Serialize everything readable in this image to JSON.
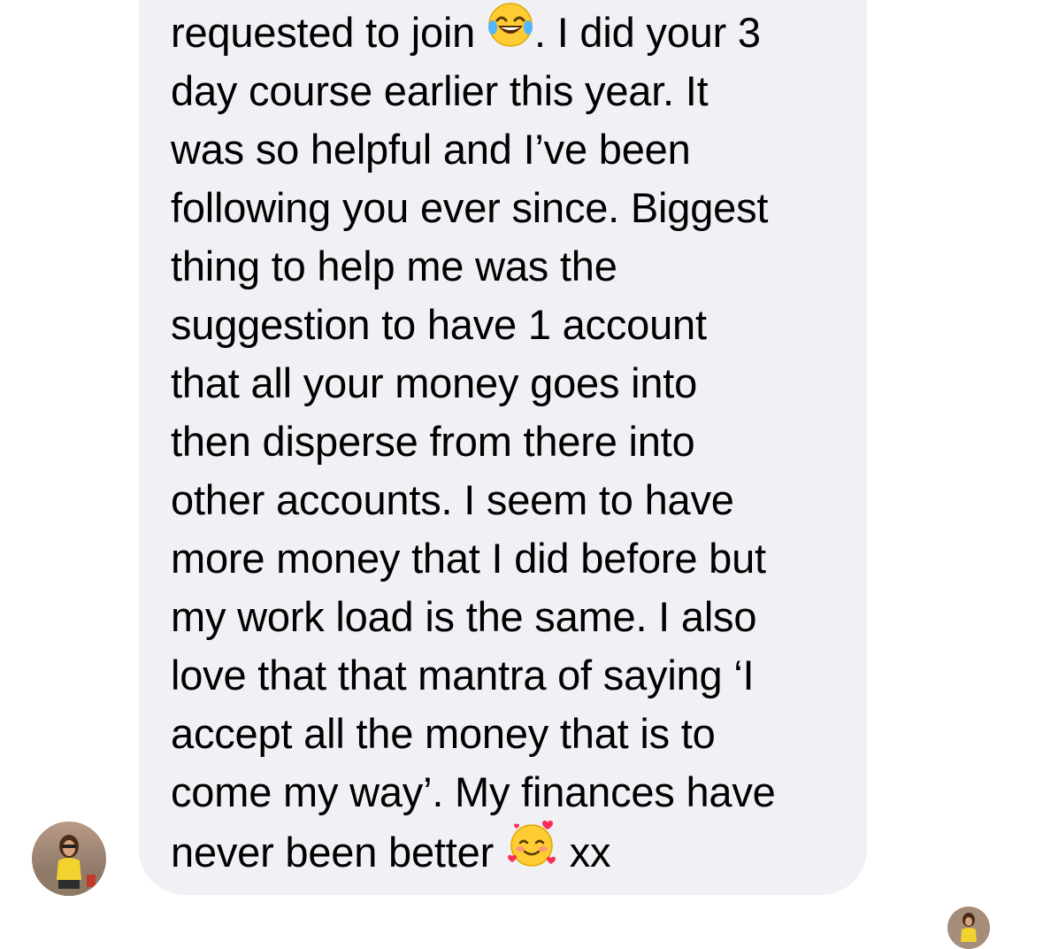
{
  "message": {
    "lines": [
      {
        "text": "requested to join",
        "emoji": "laughing-tears",
        "after": ". I did your 3"
      },
      {
        "text": "day course earlier this year. It"
      },
      {
        "text": "was so helpful and I’ve been"
      },
      {
        "text": "following you ever since. Biggest"
      },
      {
        "text": "thing to help me was the"
      },
      {
        "text": "suggestion to have 1 account"
      },
      {
        "text": "that all your money goes into"
      },
      {
        "text": "then disperse from there into"
      },
      {
        "text": "other accounts. I seem to have"
      },
      {
        "text": "more money that I did before but"
      },
      {
        "text": "my work load is the same. I also"
      },
      {
        "text": "love that that mantra of saying ‘I"
      },
      {
        "text": "accept all the money that is to"
      },
      {
        "text": "come my way’. My finances have"
      },
      {
        "text": "never been better",
        "emoji": "smiling-face-with-hearts",
        "after": "xx"
      }
    ]
  },
  "colors": {
    "bubble_background": "#f0f0f5",
    "text": "#000000"
  },
  "icons": {
    "sender_avatar": "avatar",
    "read_receipt_avatar": "avatar"
  }
}
